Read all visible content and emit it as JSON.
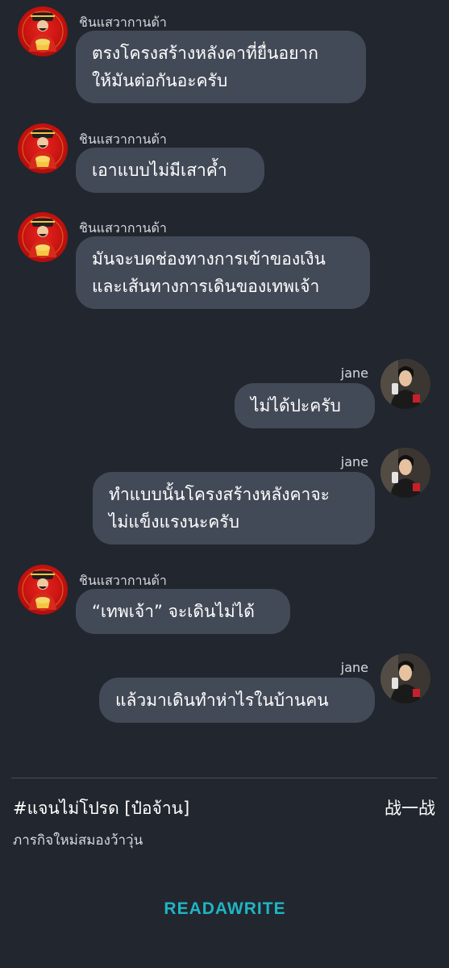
{
  "characters": {
    "god": {
      "name": "ชินแสวากานด้า",
      "avatar_icon": "god-of-wealth-avatar-icon"
    },
    "jane": {
      "name": "jane",
      "avatar_icon": "young-man-avatar-icon"
    }
  },
  "messages": [
    {
      "side": "left",
      "sender": "ชินแสวากานด้า",
      "lines": [
        "ตรงโครงสร้างหลังคาที่ยื่นอยาก",
        "ให้มันต่อกันอะครับ"
      ]
    },
    {
      "side": "left",
      "sender": "ชินแสวากานด้า",
      "lines": [
        "เอาแบบไม่มีเสาค้ำ"
      ]
    },
    {
      "side": "left",
      "sender": "ชินแสวากานด้า",
      "lines": [
        "มันจะบดช่องทางการเข้าของเงิน",
        "และเส้นทางการเดินของเทพเจ้า"
      ]
    },
    {
      "side": "right",
      "sender": "jane",
      "lines": [
        "ไม่ได้ปะครับ"
      ]
    },
    {
      "side": "right",
      "sender": "jane",
      "lines": [
        "ทำแบบนั้นโครงสร้างหลังคาจะ",
        "ไม่แข็งแรงนะครับ"
      ]
    },
    {
      "side": "left",
      "sender": "ชินแสวากานด้า",
      "lines": [
        "“เทพเจ้า” จะเดินไม่ได้"
      ]
    },
    {
      "side": "right",
      "sender": "jane",
      "lines": [
        "แล้วมาเดินทำห่าไรในบ้านคน"
      ]
    }
  ],
  "footer": {
    "book_title": "#แจนไม่โปรด [ป๋อจ้าน]",
    "author": "战一战",
    "chapter_title": "ภารกิจใหม่สมองว้าวุ่น"
  },
  "brand": {
    "logo_text": "READAWRITE",
    "color": "#1fb5c4"
  },
  "colors": {
    "background": "#22262e",
    "bubble": "#434a57"
  }
}
